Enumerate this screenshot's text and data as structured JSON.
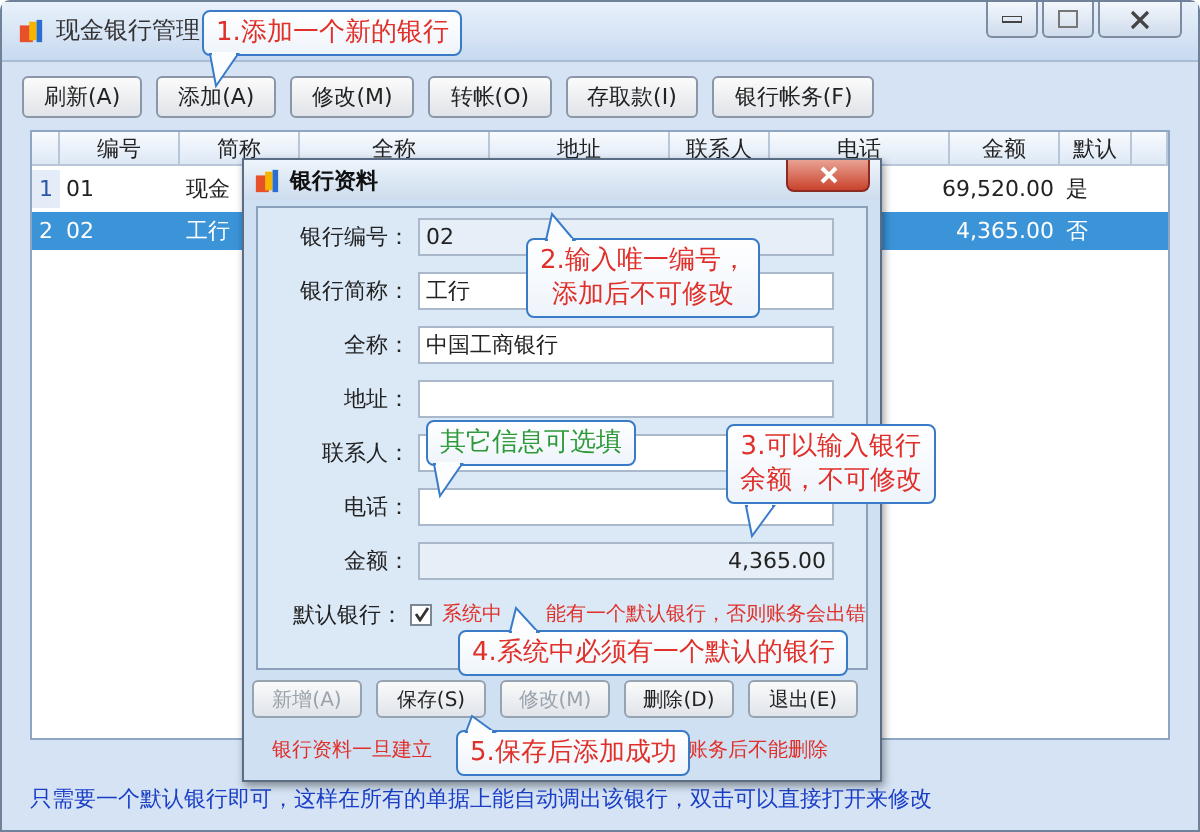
{
  "window": {
    "title": "现金银行管理"
  },
  "toolbar": [
    "刷新(A)",
    "添加(A)",
    "修改(M)",
    "转帐(O)",
    "存取款(I)",
    "银行帐务(F)"
  ],
  "grid": {
    "columns": [
      "编号",
      "简称",
      "全称",
      "地址",
      "联系人",
      "电话",
      "金额",
      "默认"
    ],
    "rows": [
      {
        "index": "1",
        "code": "01",
        "short_name": "现金",
        "amount": "69,520.00",
        "default": "是",
        "selected": false
      },
      {
        "index": "2",
        "code": "02",
        "short_name": "工行",
        "amount": "4,365.00",
        "default": "否",
        "selected": true
      }
    ]
  },
  "dialog": {
    "title": "银行资料",
    "fields": [
      {
        "label": "银行编号：",
        "value": "02",
        "disabled": true
      },
      {
        "label": "银行简称：",
        "value": "工行",
        "disabled": false
      },
      {
        "label": "全称：",
        "value": "中国工商银行",
        "disabled": false
      },
      {
        "label": "地址：",
        "disabled": false
      },
      {
        "label": "联系人：",
        "disabled": false
      },
      {
        "label": "电话：",
        "disabled": false
      },
      {
        "label": "金额：",
        "value": "4,365.00",
        "disabled": true
      }
    ],
    "default_bank": {
      "label": "默认银行：",
      "checked": true,
      "note_start": "系统中",
      "note_end": "能有一个默认银行，否则账务会出错"
    },
    "buttons": [
      {
        "label": "新增(A)",
        "disabled": true
      },
      {
        "label": "保存(S)",
        "disabled": false
      },
      {
        "label": "修改(M)",
        "disabled": true
      },
      {
        "label": "删除(D)",
        "disabled": false
      },
      {
        "label": "退出(E)",
        "disabled": false
      }
    ],
    "footer_start": "银行资料一旦建立",
    "footer_end": "账务后不能删除"
  },
  "callouts": [
    {
      "lines": [
        "1.添加一个新的银行"
      ],
      "color": "#e0302a"
    },
    {
      "lines": [
        "2.输入唯一编号，",
        "添加后不可修改"
      ],
      "color": "#e0302a"
    },
    {
      "lines": [
        "其它信息可选填"
      ],
      "color": "#2f9a3a"
    },
    {
      "lines": [
        "3.可以输入银行",
        "余额，不可修改"
      ],
      "color": "#e0302a"
    },
    {
      "lines": [
        "4.系统中必须有一个默认的银行"
      ],
      "color": "#e0302a"
    },
    {
      "lines": [
        "5.保存后添加成功"
      ],
      "color": "#e0302a"
    }
  ],
  "status": "只需要一个默认银行即可，这样在所有的单据上能自动调出该银行，双击可以直接打开来修改"
}
